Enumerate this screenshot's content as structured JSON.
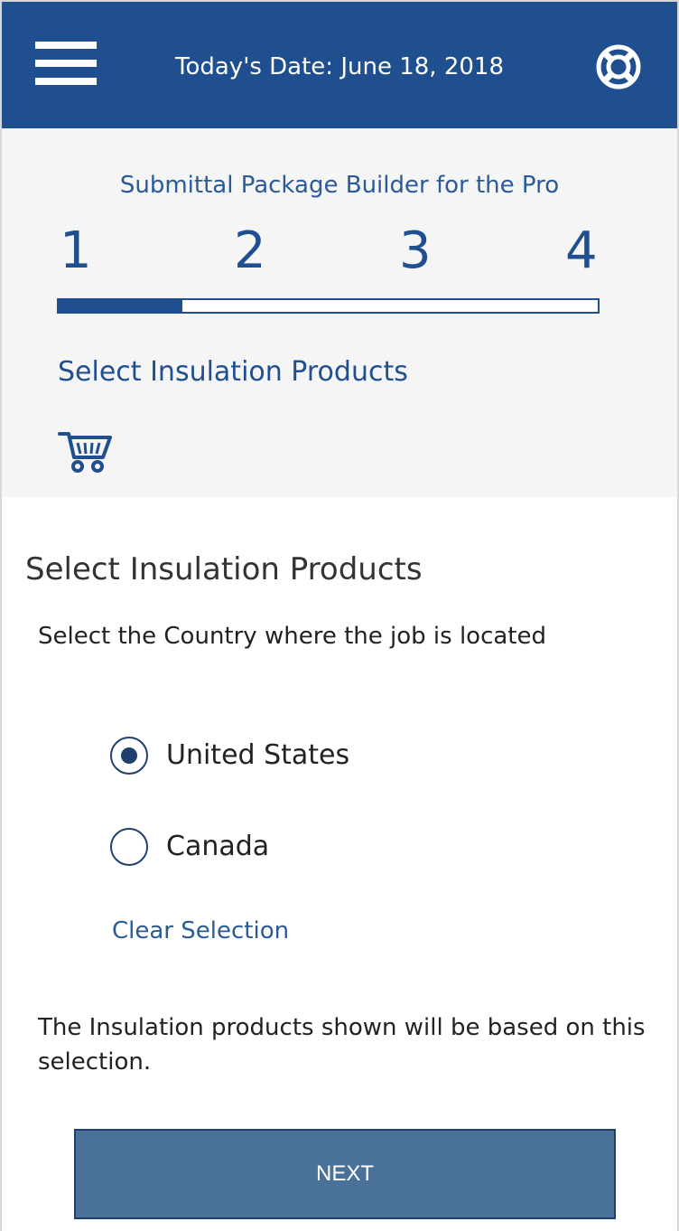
{
  "header": {
    "date_text": "Today's Date: June 18, 2018",
    "menu_icon": "hamburger-icon",
    "help_icon": "lifebuoy-icon",
    "background_color": "#1f4f8f"
  },
  "progress": {
    "title": "Submittal Package Builder for the Pro",
    "steps": [
      "1",
      "2",
      "3",
      "4"
    ],
    "current_step": 1,
    "fill_fraction": 0.23,
    "step_label": "Select Insulation Products",
    "cart_icon": "shopping-cart-icon"
  },
  "main": {
    "heading": "Select Insulation Products",
    "instruction": "Select the Country where the job is located",
    "options": [
      {
        "label": "United States",
        "checked": true
      },
      {
        "label": "Canada",
        "checked": false
      }
    ],
    "clear_label": "Clear Selection",
    "note": "The Insulation products shown will be based on this selection.",
    "next_label": "NEXT"
  }
}
